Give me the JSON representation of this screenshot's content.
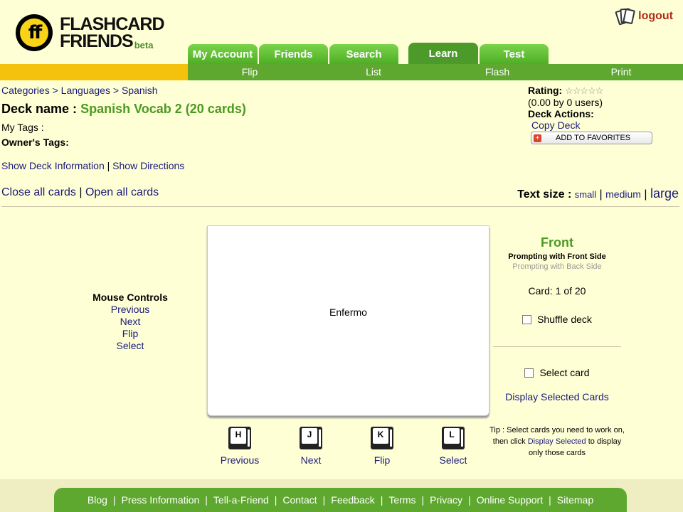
{
  "brand": {
    "logo_mark": "ff",
    "line1": "FLASHCARD",
    "line2": "FRIENDS",
    "beta": "beta"
  },
  "header": {
    "logout": "logout",
    "logout_icon": "cards-icon"
  },
  "tabs": [
    {
      "label": "My Account",
      "active": false
    },
    {
      "label": "Friends",
      "active": false
    },
    {
      "label": "Search",
      "active": false
    },
    {
      "label": "Learn",
      "active": true
    },
    {
      "label": "Test",
      "active": false
    }
  ],
  "subnav": [
    "Flip",
    "List",
    "Flash",
    "Print"
  ],
  "breadcrumb": [
    "Categories",
    "Languages",
    "Spanish"
  ],
  "deck": {
    "name_label": "Deck name :",
    "name_value": "Spanish Vocab 2 (20 cards)",
    "my_tags": "My Tags :",
    "owners_tags": "Owner's Tags:",
    "show_info": "Show Deck Information",
    "show_directions": "Show Directions",
    "close_all": "Close all cards",
    "open_all": "Open all cards"
  },
  "rating": {
    "label": "Rating:",
    "stars": "☆☆☆☆☆",
    "value": "(0.00 by 0 users)",
    "actions_label": "Deck Actions:",
    "copy_deck": "Copy Deck",
    "add_favorites": "ADD TO FAVORITES"
  },
  "text_size": {
    "label": "Text size :",
    "small": "small",
    "medium": "medium",
    "large": "large"
  },
  "mouse_controls": {
    "title": "Mouse Controls",
    "previous": "Previous",
    "next": "Next",
    "flip": "Flip",
    "select": "Select"
  },
  "card": {
    "text": "Enfermo"
  },
  "keys": [
    {
      "key": "H",
      "label": "Previous"
    },
    {
      "key": "J",
      "label": "Next"
    },
    {
      "key": "K",
      "label": "Flip"
    },
    {
      "key": "L",
      "label": "Select"
    }
  ],
  "side_panel": {
    "side": "Front",
    "prompt_front": "Prompting with Front Side",
    "prompt_back": "Prompting with Back Side",
    "card_count": "Card: 1 of 20",
    "shuffle": "Shuffle deck",
    "select_card": "Select card",
    "display_selected": "Display Selected Cards",
    "tip_prefix": "Tip : Select cards you need to work on, then click",
    "tip_link": "Display Selected",
    "tip_suffix": "to display only those cards"
  },
  "footer": [
    "Blog",
    "Press Information",
    "Tell-a-Friend",
    "Contact",
    "Feedback",
    "Terms",
    "Privacy",
    "Online Support",
    "Sitemap"
  ],
  "colors": {
    "background": "#ffffd6",
    "green": "#5ea82f",
    "yellow": "#f4c20c",
    "link": "#1a1a7a",
    "accent_green_text": "#4a9a22"
  }
}
